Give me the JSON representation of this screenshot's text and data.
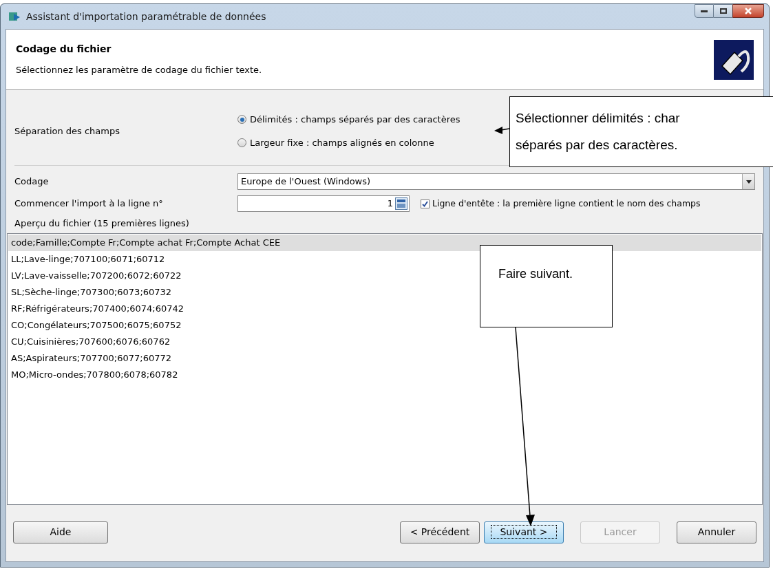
{
  "window": {
    "title": "Assistant d'importation paramétrable de données"
  },
  "header": {
    "title": "Codage du fichier",
    "subtitle": "Sélectionnez les paramètre de codage du fichier texte."
  },
  "separation": {
    "label": "Séparation des champs",
    "options": [
      {
        "label": "Délimités : champs séparés par des caractères",
        "selected": true
      },
      {
        "label": "Largeur fixe : champs alignés en colonne",
        "selected": false
      }
    ]
  },
  "encoding": {
    "label": "Codage",
    "value": "Europe de l'Ouest (Windows)"
  },
  "start_line": {
    "label": "Commencer l'import à la ligne n°",
    "value": "1"
  },
  "header_line": {
    "label": "Ligne d'entête : la première ligne contient le nom des champs",
    "checked": true
  },
  "preview": {
    "label": "Aperçu du fichier (15 premières lignes)",
    "lines": [
      {
        "text": "code;Famille;Compte Fr;Compte achat Fr;Compte Achat CEE",
        "selected": true
      },
      {
        "text": "LL;Lave-linge;707100;6071;60712",
        "selected": false
      },
      {
        "text": "LV;Lave-vaisselle;707200;6072;60722",
        "selected": false
      },
      {
        "text": "SL;Sèche-linge;707300;6073;60732",
        "selected": false
      },
      {
        "text": "RF;Réfrigérateurs;707400;6074;60742",
        "selected": false
      },
      {
        "text": "CO;Congélateurs;707500;6075;60752",
        "selected": false
      },
      {
        "text": "CU;Cuisinières;707600;6076;60762",
        "selected": false
      },
      {
        "text": "AS;Aspirateurs;707700;6077;60772",
        "selected": false
      },
      {
        "text": "MO;Micro-ondes;707800;6078;60782",
        "selected": false
      }
    ]
  },
  "buttons": [
    {
      "label": "Aide",
      "kind": "help",
      "disabled": false,
      "focused": false
    },
    {
      "label": "< Précédent",
      "kind": "nav",
      "disabled": false,
      "focused": false
    },
    {
      "label": "Suivant >",
      "kind": "nav",
      "disabled": false,
      "focused": true
    },
    {
      "label": "Lancer",
      "kind": "nav",
      "disabled": true,
      "focused": false
    },
    {
      "label": "Annuler",
      "kind": "cancel",
      "disabled": false,
      "focused": false
    }
  ],
  "callouts": [
    {
      "lines": [
        "Sélectionner délimités : char",
        "séparés par des caractères."
      ]
    },
    {
      "lines": [
        "Faire suivant."
      ]
    }
  ]
}
